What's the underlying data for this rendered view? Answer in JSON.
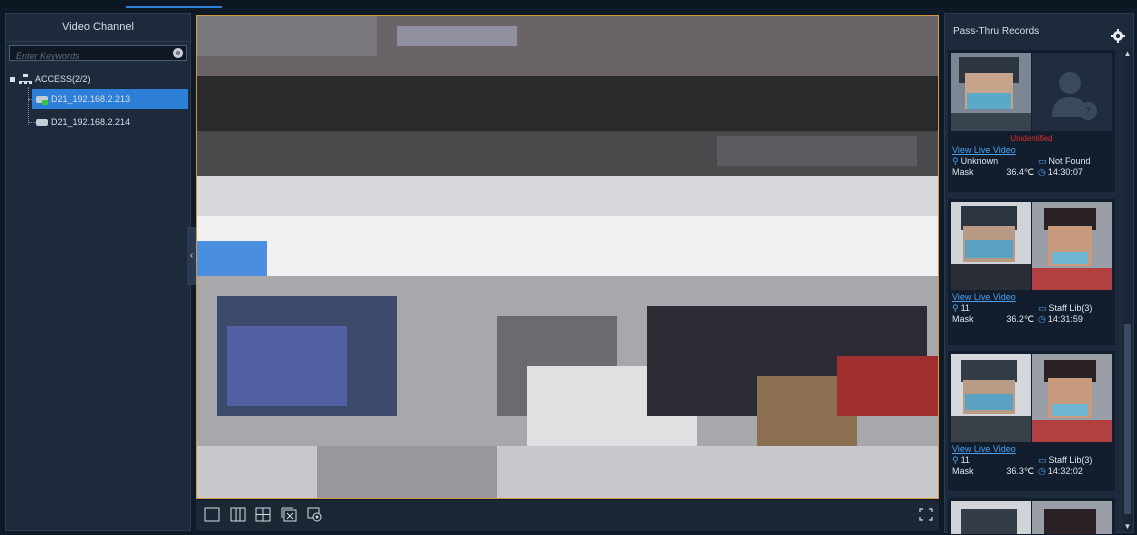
{
  "left_panel": {
    "title": "Video Channel",
    "search_placeholder": "Enter Keywords",
    "tree": {
      "root_label": "ACCESS(2/2)",
      "children": [
        {
          "label": "D21_192.168.2.213",
          "selected": true
        },
        {
          "label": "D21_192.168.2.214",
          "selected": false
        }
      ]
    }
  },
  "toolbar": {
    "tools": [
      "single-view-icon",
      "three-split-icon",
      "four-split-icon",
      "close-all-icon",
      "snapshot-icon",
      "fullscreen-icon"
    ]
  },
  "right_panel": {
    "title": "Pass-Thru Records",
    "records": [
      {
        "status": "Unidentified",
        "link": "View Live Video",
        "person": "Unknown",
        "library": "Not Found",
        "mask": "Mask",
        "temp": "36.4℃",
        "time": "14:30:07"
      },
      {
        "status": "",
        "link": "View Live Video",
        "person": "11",
        "library": "Staff Lib(3)",
        "mask": "Mask",
        "temp": "36.2℃",
        "time": "14:31:59"
      },
      {
        "status": "",
        "link": "View Live Video",
        "person": "11",
        "library": "Staff Lib(3)",
        "mask": "Mask",
        "temp": "36.3℃",
        "time": "14:32:02"
      }
    ]
  },
  "colors": {
    "accent": "#2d7fd8",
    "video_border": "#d29a3e",
    "unidentified": "#e02d2d",
    "link": "#4aa3f2"
  }
}
